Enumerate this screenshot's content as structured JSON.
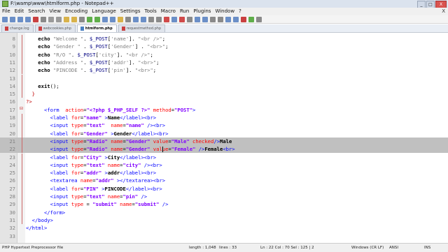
{
  "window": {
    "title": "F:\\wamp\\www\\htmlform.php - Notepad++",
    "buttons": [
      "_",
      "□",
      "X"
    ]
  },
  "menu": [
    "File",
    "Edit",
    "Search",
    "View",
    "Encoding",
    "Language",
    "Settings",
    "Tools",
    "Macro",
    "Run",
    "Plugins",
    "Window",
    "?"
  ],
  "menu_close": "X",
  "toolbar_colors": [
    "#6b8fc7",
    "#6b8fc7",
    "#6b8fc7",
    "#6b8fc7",
    "#c94040",
    "#8a8a8a",
    "#9a9a9a",
    "#9a9a9a",
    "#d8b24a",
    "#d8b24a",
    "#8a8a8a",
    "#5fae4a",
    "#5fae4a",
    "#6b8fc7",
    "#6b8fc7",
    "#d8b24a",
    "#8a8a8a",
    "#6b8fc7",
    "#6b8fc7",
    "#8a8a8a",
    "#8a8a8a",
    "#d04a4a",
    "#6b8fc7",
    "#d04a4a",
    "#8a8a8a",
    "#6b8fc7",
    "#6b8fc7",
    "#8a8a8a",
    "#8a8a8a",
    "#6b8fc7",
    "#6b8fc7",
    "#c94040",
    "#5fae4a",
    "#8a8a8a"
  ],
  "tabs": [
    {
      "label": "change.log",
      "active": false
    },
    {
      "label": "webcookies.php",
      "active": false
    },
    {
      "label": "htmlform.php",
      "active": true
    },
    {
      "label": "requestmethod.php",
      "active": false
    }
  ],
  "lines": [
    {
      "n": "8",
      "html": "<span class=\"b\">    echo</span> <span class=\"s\">\"Welcome \"</span>. <span class=\"v\">$_POST</span>[<span class=\"s\">'name'</span>]. <span class=\"s\">\"&lt;br /&gt;\"</span>;"
    },
    {
      "n": "9",
      "html": "<span class=\"b\">    echo</span> <span class=\"s\">\"Gender \"</span> . <span class=\"v\">$_POST</span>[<span class=\"s\">'Gender'</span>] . <span class=\"s\">\"&lt;br&gt;\"</span>;"
    },
    {
      "n": "10",
      "html": "<span class=\"b\">    echo</span> <span class=\"s\">\"R/O \"</span>. <span class=\"v\">$_POST</span>[<span class=\"s\">'city'</span>]. <span class=\"s\">\"&lt;br /&gt;\"</span>;"
    },
    {
      "n": "11",
      "html": "<span class=\"b\">    echo</span> <span class=\"s\">\"Address \"</span>. <span class=\"v\">$_POST</span>[<span class=\"s\">'addr'</span>]. <span class=\"s\">\"&lt;br&gt;\"</span>;"
    },
    {
      "n": "12",
      "html": "<span class=\"b\">    echo</span> <span class=\"s\">\"PINCODE \"</span>. <span class=\"v\">$_POST</span>[<span class=\"s\">'pin'</span>]. <span class=\"s\">\"&lt;br&gt;\"</span>;"
    },
    {
      "n": "13",
      "html": ""
    },
    {
      "n": "14",
      "html": "<span class=\"b\">    exit</span>();"
    },
    {
      "n": "15",
      "html": "  <span class=\"php\">}</span>"
    },
    {
      "n": "16",
      "html": "<span class=\"php\">?&gt;</span>"
    },
    {
      "n": "17",
      "html": "      <span class=\"tag\">&lt;form</span>  <span class=\"attr\">action</span>=<span class=\"str\">\"&lt;?php $_PHP_SELF ?&gt;\"</span> <span class=\"attr\">method</span>=<span class=\"str\">\"POST\"</span><span class=\"tag\">&gt;</span>"
    },
    {
      "n": "18",
      "html": "        <span class=\"tag\">&lt;label</span> <span class=\"attr\">for</span>=<span class=\"str\">\"name\"</span> <span class=\"tag\">&gt;</span><span class=\"b\">Name</span><span class=\"tag\">&lt;/label&gt;&lt;br&gt;</span>"
    },
    {
      "n": "19",
      "html": "        <span class=\"tag\">&lt;input</span> <span class=\"attr\">type</span>=<span class=\"str\">\"text\"</span>  <span class=\"attr\">name</span>=<span class=\"str\">\"name\"</span> <span class=\"tag\">/&gt;&lt;br&gt;</span>"
    },
    {
      "n": "20",
      "html": "        <span class=\"tag\">&lt;label</span> <span class=\"attr\">for</span>=<span class=\"str\">\"Gender\"</span> <span class=\"tag\">&gt;</span><span class=\"b\">Gender</span><span class=\"tag\">&lt;/label&gt;&lt;br&gt;</span>"
    },
    {
      "n": "21",
      "sel": true,
      "html": "        <span class=\"tag\">&lt;input</span> <span class=\"attr\">type</span>=<span class=\"str\">\"Radio\"</span> <span class=\"attr\">name</span>=<span class=\"str\">\"Gender\"</span> <span class=\"attr\">value</span>=<span class=\"str\">\"Male\"</span> <span class=\"attr\">checked</span><span class=\"tag\">/&gt;</span><span class=\"b\">Male</span>"
    },
    {
      "n": "22",
      "sel": true,
      "html": "        <span class=\"tag\">&lt;input</span> <span class=\"attr\">type</span>=<span class=\"str\">\"Radio\"</span> <span class=\"attr\">name</span>=<span class=\"str\">\"Gender\"</span> <span class=\"attr\">value</span>=<span class=\"str\">\"Female\"</span> <span class=\"tag\">/&gt;</span><span class=\"b\">Female</span><span class=\"tag\">&lt;br&gt;</span>"
    },
    {
      "n": "23",
      "html": "        <span class=\"tag\">&lt;label</span> <span class=\"attr\">for</span>=<span class=\"str\">\"City\"</span> <span class=\"tag\">&gt;</span><span class=\"b\">City</span><span class=\"tag\">&lt;/label&gt;&lt;br&gt;</span>"
    },
    {
      "n": "24",
      "html": "        <span class=\"tag\">&lt;input</span> <span class=\"attr\">type</span>=<span class=\"str\">\"text\"</span> <span class=\"attr\">name</span>=<span class=\"str\">\"city\"</span> <span class=\"tag\">/&gt;&lt;br&gt;</span>"
    },
    {
      "n": "25",
      "html": "        <span class=\"tag\">&lt;label</span> <span class=\"attr\">for</span>=<span class=\"str\">\"addr\"</span> <span class=\"tag\">&gt;</span><span class=\"b\">addr</span><span class=\"tag\">&lt;/label&gt;&lt;br&gt;</span>"
    },
    {
      "n": "26",
      "html": "        <span class=\"tag\">&lt;textarea</span> <span class=\"attr\">name</span>=<span class=\"str\">\"addr\"</span> <span class=\"tag\">&gt;&lt;/textarea&gt;&lt;br&gt;</span>"
    },
    {
      "n": "27",
      "html": "        <span class=\"tag\">&lt;label</span> <span class=\"attr\">for</span>=<span class=\"str\">\"PIN\"</span> <span class=\"tag\">&gt;</span><span class=\"b\">PINCODE</span><span class=\"tag\">&lt;/label&gt;&lt;br&gt;</span>"
    },
    {
      "n": "28",
      "html": "        <span class=\"tag\">&lt;input</span> <span class=\"attr\">type</span>=<span class=\"str\">\"text\"</span> <span class=\"attr\">name</span>=<span class=\"str\">\"pin\"</span> <span class=\"tag\">/&gt;</span>"
    },
    {
      "n": "29",
      "html": "        <span class=\"tag\">&lt;input</span> <span class=\"attr\">type</span> = <span class=\"str\">\"submit\"</span> <span class=\"attr\">name</span>=<span class=\"str\">\"submit\"</span> <span class=\"tag\">/&gt;</span>"
    },
    {
      "n": "30",
      "html": "      <span class=\"tag\">&lt;/form&gt;</span>"
    },
    {
      "n": "31",
      "html": "  <span class=\"tag\">&lt;/body&gt;</span>"
    },
    {
      "n": "32",
      "html": "<span class=\"tag\">&lt;/html&gt;</span>"
    },
    {
      "n": "33",
      "html": ""
    }
  ],
  "status": {
    "file_type": "PHP Hypertext Preprocessor file",
    "length": "length : 1,048",
    "lines": "lines : 33",
    "position": "Ln : 22   Col : 70   Sel : 125 | 2",
    "eol": "Windows (CR LF)",
    "encoding": "ANSI",
    "mode": "INS"
  }
}
